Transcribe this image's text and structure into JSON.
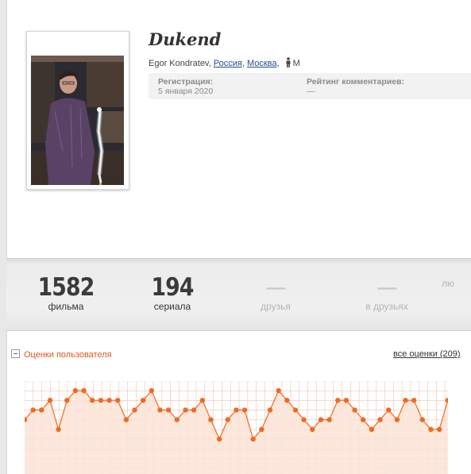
{
  "profile": {
    "username": "Dukend",
    "full_name": "Egor Kondratev,",
    "country": "Россия",
    "city": "Москва",
    "sep": ",",
    "gender": "М",
    "registration_label": "Регистрация:",
    "registration_date": "5 января 2020",
    "comment_rating_label": "Рейтинг комментариев:",
    "comment_rating_value": "—"
  },
  "stats": [
    {
      "value": "1582",
      "label": "фильма"
    },
    {
      "value": "194",
      "label": "сериала"
    },
    {
      "value": "—",
      "label": "друзья"
    },
    {
      "value": "—",
      "label": "в друзьях"
    },
    {
      "value": "",
      "label": "лю"
    }
  ],
  "ratings": {
    "title": "Оценки пользователя",
    "all_link": "все оценки (209)"
  },
  "chart_data": {
    "type": "area",
    "ylim": [
      1,
      10
    ],
    "grid": true,
    "colors": {
      "line": "#f06a22",
      "fill": "#fce3d6",
      "grid": "#e9c4b2"
    },
    "values": [
      7,
      8,
      8,
      9,
      6,
      9,
      10,
      10,
      9,
      9,
      9,
      9,
      7,
      8,
      9,
      10,
      8,
      8,
      7,
      8,
      8,
      9,
      7,
      5,
      7,
      8,
      8,
      5,
      6,
      8,
      10,
      9,
      8,
      7,
      6,
      7,
      7,
      9,
      9,
      8,
      7,
      6,
      7,
      8,
      7,
      9,
      9,
      7,
      6,
      6,
      9
    ]
  },
  "colors": {
    "accent": "#e0561b",
    "link": "#1f4d8c"
  }
}
